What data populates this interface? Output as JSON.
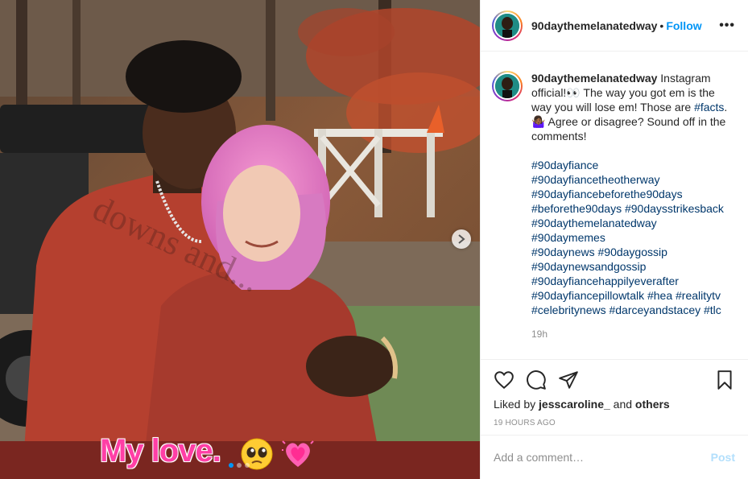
{
  "photo": {
    "overlay_text": "My love.",
    "next_icon": "chevron-right-icon",
    "carousel": {
      "count": 3,
      "active": 1
    }
  },
  "header": {
    "username": "90daythemelanatedway",
    "separator": "•",
    "follow_label": "Follow",
    "more_icon": "more-options-icon",
    "more_label": "•••"
  },
  "caption": {
    "username": "90daythemelanatedway",
    "text_1": " Instagram official!👀 The way you got em is the way you will lose em! Those are ",
    "facts_tag": "#facts",
    "text_2": ". 🤷🏾‍♀️ Agree or disagree? Sound off in the comments!",
    "hashtags": [
      "#90dayfiance",
      "#90dayfiancetheotherway",
      "#90dayfiancebeforethe90days",
      "#beforethe90days #90daysstrikesback",
      "#90daythemelanatedway",
      "#90daymemes",
      "#90daynews #90daygossip",
      "#90daynewsandgossip",
      "#90dayfiancehappilyeverafter",
      "#90dayfiancepillowtalk #hea #realitytv",
      "#celebritynews #darceyandstacey #tlc"
    ],
    "time": "19h"
  },
  "actions": {
    "like_icon": "heart-icon",
    "comment_icon": "comment-icon",
    "share_icon": "share-icon",
    "save_icon": "bookmark-icon",
    "liked_by_prefix": "Liked by ",
    "liked_by_user": "jesscaroline_",
    "liked_by_and": " and ",
    "liked_by_others": "others",
    "timestamp": "19 HOURS AGO"
  },
  "add_comment": {
    "placeholder": "Add a comment…",
    "post_label": "Post"
  },
  "colors": {
    "accent": "#0095f6",
    "hashtag": "#00376b",
    "overlay_text": "#ff3fa6",
    "post_disabled": "#b2dffc"
  }
}
